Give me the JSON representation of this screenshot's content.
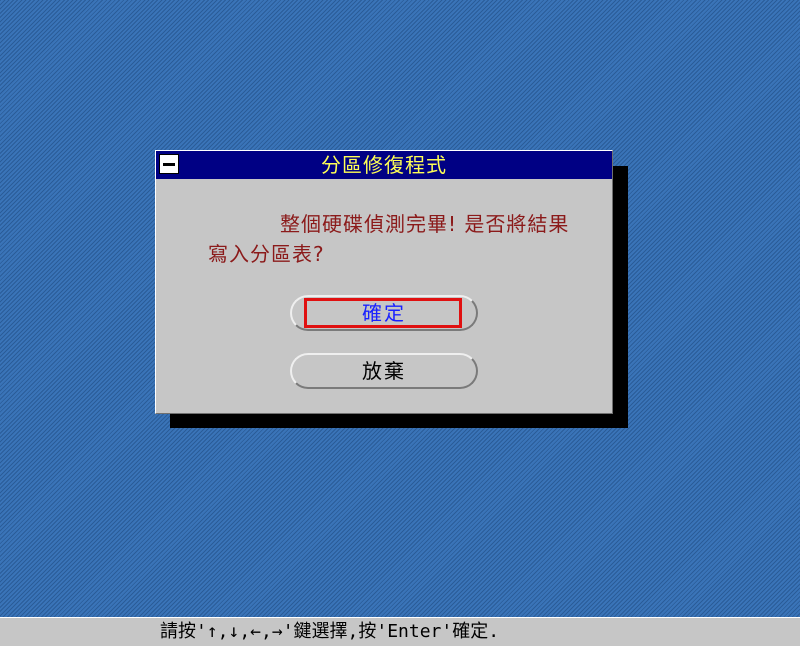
{
  "dialog": {
    "title": "分區修復程式",
    "message": "整個硬碟偵測完畢! 是否將結果寫入分區表?",
    "buttons": {
      "ok_label": "確定",
      "cancel_label": "放棄"
    }
  },
  "status_bar": {
    "text": "請按'↑,↓,←,→'鍵選擇,按'Enter'確定."
  },
  "icons": {
    "system_menu": "minus-icon"
  },
  "colors": {
    "desktop": "#2f66a8",
    "title_bar": "#000084",
    "title_text": "#ffff55",
    "message_text": "#8b1a1a",
    "ok_text": "#1a22ff",
    "focus_ring": "#e01010",
    "dialog_face": "#c6c6c6"
  }
}
